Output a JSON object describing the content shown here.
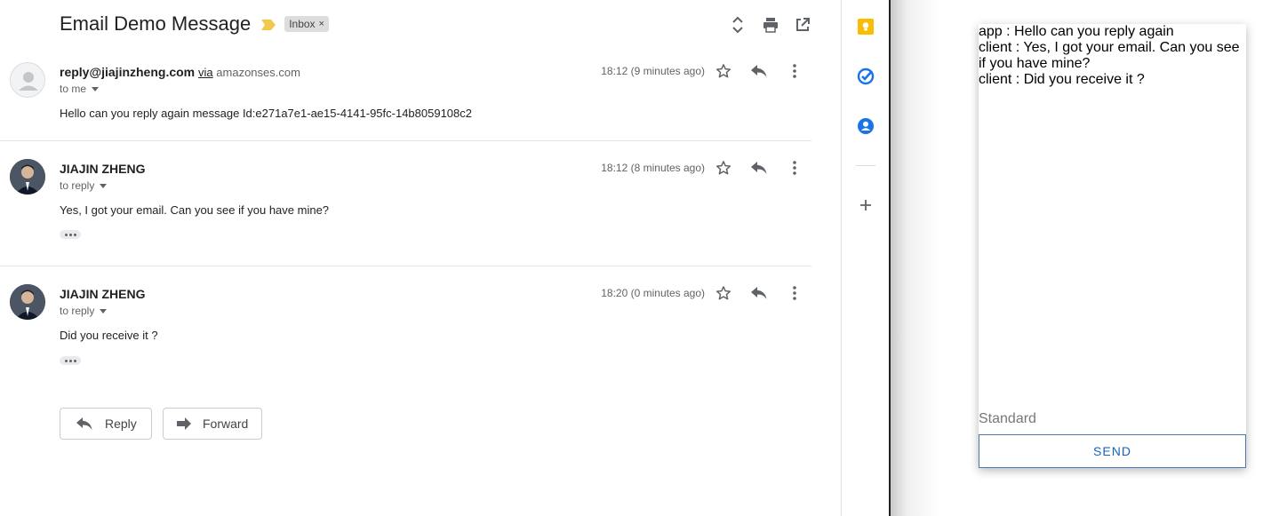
{
  "email": {
    "subject": "Email Demo Message",
    "label": "Inbox",
    "label_close": "×",
    "messages": [
      {
        "sender": "reply@jiajinzheng.com",
        "via_word": "via",
        "via_domain": "amazonses.com",
        "recipient": "to me",
        "time": "18:12 (9 minutes ago)",
        "body": "Hello can you reply again message Id:e271a7e1-ae15-4141-95fc-14b8059108c2"
      },
      {
        "sender": "JIAJIN ZHENG",
        "recipient": "to reply",
        "time": "18:12 (8 minutes ago)",
        "body": "Yes, I got your email. Can you see if you have mine?"
      },
      {
        "sender": "JIAJIN ZHENG",
        "recipient": "to reply",
        "time": "18:20 (0 minutes ago)",
        "body": "Did you receive it ?"
      }
    ],
    "reply_label": "Reply",
    "forward_label": "Forward"
  },
  "sidepanel": {
    "icons": [
      "keep-icon",
      "tasks-icon",
      "contacts-icon",
      "add-icon"
    ],
    "keep_color": "#fbbc04",
    "tasks_color": "#1a73e8",
    "contacts_color": "#1a73e8"
  },
  "chat": {
    "lines": [
      "app : Hello can you reply again",
      "client : Yes, I got your email. Can you see if you have mine?",
      "client : Did you receive it ?"
    ],
    "mode": "Standard",
    "send_label": "SEND",
    "accent": "#1565c0"
  }
}
